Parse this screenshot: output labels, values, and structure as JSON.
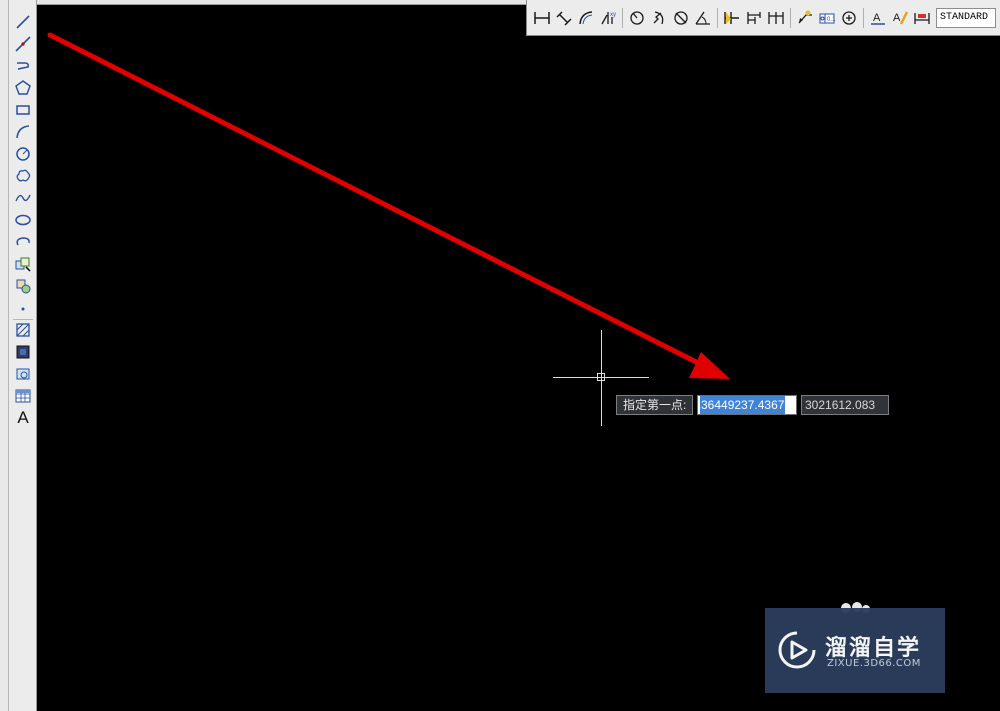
{
  "left_toolbar": {
    "tools": [
      {
        "name": "line-icon"
      },
      {
        "name": "construction-line-icon"
      },
      {
        "name": "polyline-icon"
      },
      {
        "name": "polygon-icon"
      },
      {
        "name": "rectangle-icon"
      },
      {
        "name": "arc-icon"
      },
      {
        "name": "circle-icon"
      },
      {
        "name": "revision-cloud-icon"
      },
      {
        "name": "spline-icon"
      },
      {
        "name": "ellipse-icon"
      },
      {
        "name": "ellipse-arc-icon"
      },
      {
        "name": "insert-block-icon"
      },
      {
        "name": "make-block-icon"
      },
      {
        "name": "point-icon"
      },
      {
        "name": "hatch-icon"
      },
      {
        "name": "gradient-icon"
      },
      {
        "name": "region-icon"
      },
      {
        "name": "table-icon"
      },
      {
        "name": "multiline-text-icon"
      }
    ],
    "text_tool_glyph": "A"
  },
  "dim_toolbar": {
    "style_value": "STANDARD"
  },
  "dynamic_input": {
    "prompt": "指定第一点:",
    "x_value": "36449237.4367",
    "y_value": "3021612.083"
  },
  "watermark": {
    "title": "溜溜自学",
    "url": "ZIXUE.3D66.COM"
  },
  "colors": {
    "canvas": "#000000",
    "arrow": "#e00000",
    "selection": "#3f84d6",
    "watermark_bg": "#2c3e5e"
  }
}
